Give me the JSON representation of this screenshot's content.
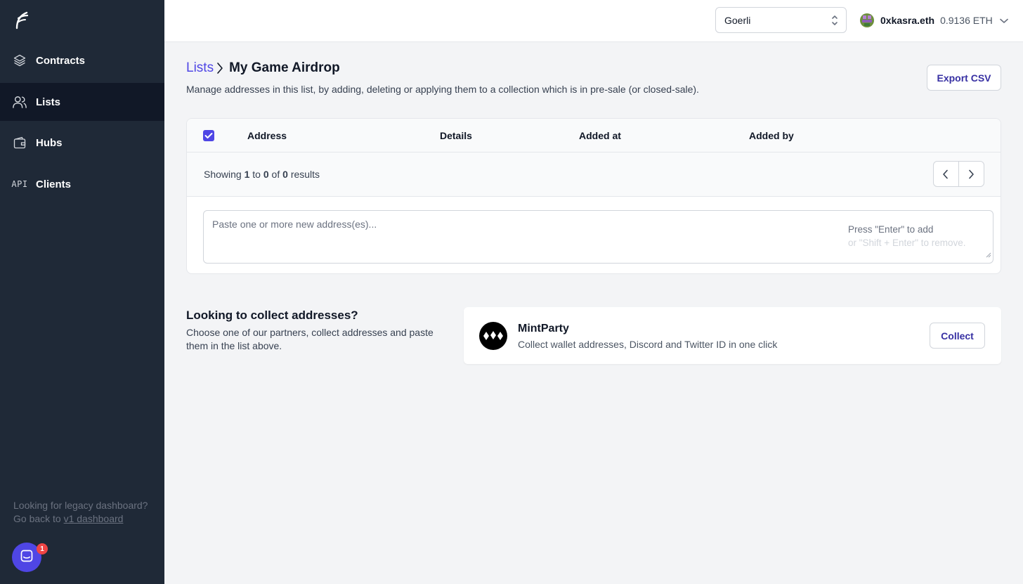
{
  "sidebar": {
    "logo": "flair-logo",
    "items": [
      {
        "label": "Contracts",
        "icon": "stack-icon"
      },
      {
        "label": "Lists",
        "icon": "users-icon",
        "active": true
      },
      {
        "label": "Hubs",
        "icon": "wallet-icon"
      },
      {
        "label": "Clients",
        "icon": "api-icon",
        "glyph": "API"
      }
    ],
    "legacy_text": "Looking for legacy dashboard?",
    "legacy_prefix": "Go back to",
    "legacy_link": "v1 dashboard",
    "chat_badge": "1"
  },
  "topbar": {
    "network": "Goerli",
    "account_name": "0xkasra.eth",
    "balance": "0.9136 ETH"
  },
  "header": {
    "breadcrumb_link": "Lists",
    "title": "My Game Airdrop",
    "subtitle": "Manage addresses in this list, by adding, deleting or applying them to a collection which is in pre-sale (or closed-sale).",
    "export_label": "Export CSV"
  },
  "table": {
    "columns": [
      "Address",
      "Details",
      "Added at",
      "Added by"
    ],
    "showing_prefix": "Showing",
    "showing_from": "1",
    "showing_to_word": "to",
    "showing_to": "0",
    "showing_of_word": "of",
    "showing_total": "0",
    "showing_suffix": "results",
    "add_placeholder": "Paste one or more new address(es)...",
    "hint_add": "Press \"Enter\" to add",
    "hint_remove": "or \"Shift + Enter\" to remove."
  },
  "collect": {
    "title": "Looking to collect addresses?",
    "description": "Choose one of our partners, collect addresses and paste them in the list above.",
    "partner_name": "MintParty",
    "partner_description": "Collect wallet addresses, Discord and Twitter ID in one click",
    "button_label": "Collect"
  },
  "colors": {
    "sidebar_bg": "#1f2937",
    "sidebar_active": "#111827",
    "accent": "#4f46e5",
    "badge": "#ef4444"
  }
}
